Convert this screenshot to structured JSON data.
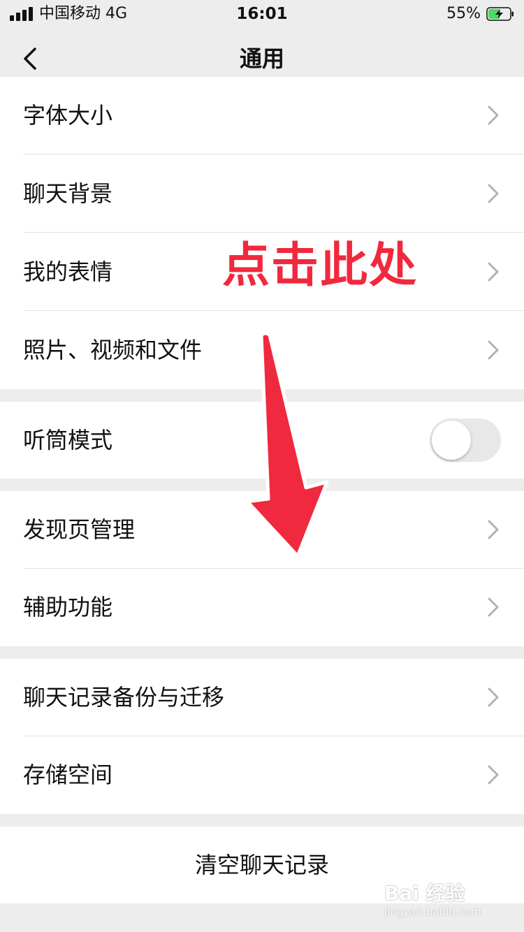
{
  "status_bar": {
    "carrier": "中国移动  4G",
    "time": "16:01",
    "battery_percent": "55%",
    "battery_level": 0.55,
    "charging": true
  },
  "nav": {
    "title": "通用",
    "back_icon": "chevron-left-icon"
  },
  "groups": [
    {
      "items": [
        {
          "label": "字体大小",
          "icon": "chevron-right-icon"
        },
        {
          "label": "聊天背景",
          "icon": "chevron-right-icon"
        },
        {
          "label": "我的表情",
          "icon": "chevron-right-icon"
        },
        {
          "label": "照片、视频和文件",
          "icon": "chevron-right-icon"
        }
      ]
    },
    {
      "items": [
        {
          "label": "听筒模式",
          "toggle": false
        }
      ]
    },
    {
      "items": [
        {
          "label": "发现页管理",
          "icon": "chevron-right-icon"
        },
        {
          "label": "辅助功能",
          "icon": "chevron-right-icon"
        }
      ]
    },
    {
      "items": [
        {
          "label": "聊天记录备份与迁移",
          "icon": "chevron-right-icon"
        },
        {
          "label": "存储空间",
          "icon": "chevron-right-icon"
        }
      ]
    }
  ],
  "clear_button": {
    "label": "清空聊天记录"
  },
  "annotation": {
    "text": "点击此处",
    "color": "#f0293e"
  },
  "watermark": {
    "text": "Bai 经验",
    "sub": "jingyan.baidu.com"
  },
  "colors": {
    "background": "#ededed",
    "card": "#ffffff",
    "toggle_off": "#e8e8e8",
    "chevron": "#b2b2b2",
    "battery_fill": "#4cd964"
  }
}
